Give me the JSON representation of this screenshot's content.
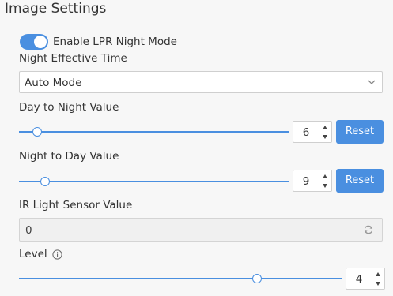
{
  "section_title": "Image Settings",
  "night_mode": {
    "label": "Enable LPR Night Mode",
    "enabled": true
  },
  "effective_time": {
    "label": "Night Effective Time",
    "value": "Auto Mode"
  },
  "day_to_night": {
    "label": "Day to Night Value",
    "value": "6",
    "reset_label": "Reset"
  },
  "night_to_day": {
    "label": "Night to Day Value",
    "value": "9",
    "reset_label": "Reset"
  },
  "ir_sensor": {
    "label": "IR Light Sensor Value",
    "value": "0"
  },
  "level": {
    "label": "Level",
    "value": "4"
  },
  "colors": {
    "accent": "#4a8fe0"
  },
  "icons": [
    "chevron-down-icon",
    "spin-up-icon",
    "spin-down-icon",
    "refresh-icon",
    "info-icon"
  ]
}
